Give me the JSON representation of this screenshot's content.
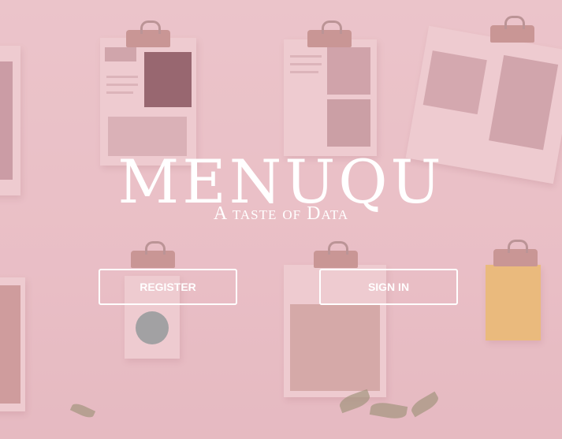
{
  "hero": {
    "title": "MENUQU",
    "subtitle": "A taste of Data"
  },
  "actions": {
    "register_label": "REGISTER",
    "signin_label": "SIGN IN"
  },
  "colors": {
    "overlay": "#e2a0aa",
    "text": "#ffffff"
  }
}
